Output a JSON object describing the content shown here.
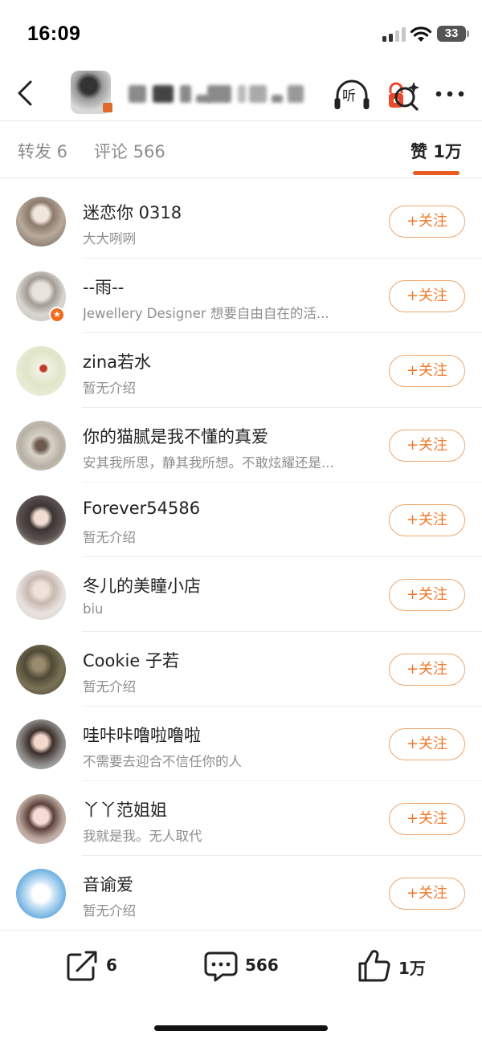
{
  "status_bar": {
    "time": "16:09",
    "battery": "33"
  },
  "nav": {
    "listen_label": "听"
  },
  "tabs": [
    {
      "label": "转发 6"
    },
    {
      "label": "评论 566"
    },
    {
      "label": "赞 1万"
    }
  ],
  "follow_label": "+关注",
  "users": [
    {
      "name": "迷恋你 0318",
      "desc": "大大咧咧"
    },
    {
      "name": "--雨--",
      "desc": "Jewellery Designer 想要自由自在的活..."
    },
    {
      "name": "zina若水",
      "desc": "暂无介绍"
    },
    {
      "name": "你的猫腻是我不懂的真爱",
      "desc": "安其我所思，静其我所想。不敢炫耀还是..."
    },
    {
      "name": "Forever54586",
      "desc": "暂无介绍"
    },
    {
      "name": "冬儿的美瞳小店",
      "desc": "biu"
    },
    {
      "name": "Cookie 子若",
      "desc": "暂无介绍"
    },
    {
      "name": "哇咔咔噜啦噜啦",
      "desc": "不需要去迎合不信任你的人"
    },
    {
      "name": "丫丫范姐姐",
      "desc": "我就是我。无人取代"
    },
    {
      "name": "音谕爱",
      "desc": "暂无介绍"
    }
  ],
  "bottom_bar": {
    "repost_count": "6",
    "comment_count": "566",
    "like_count": "1万"
  },
  "colors": {
    "accent": "#ea5b24",
    "follow": "#ec7a2e",
    "muted": "#8e8e8e"
  }
}
